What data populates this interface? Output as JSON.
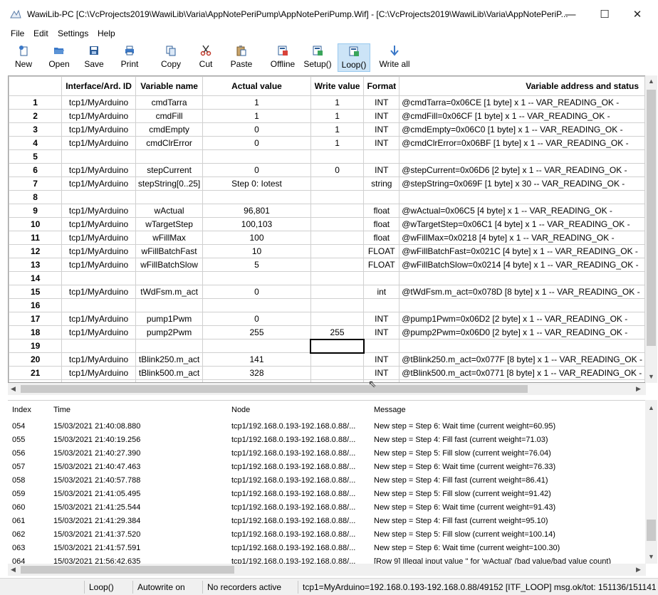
{
  "window": {
    "title": "WawiLib-PC [C:\\VcProjects2019\\WawiLib\\Varia\\AppNotePeriPump\\AppNotePeriPump.Wif] - [C:\\VcProjects2019\\WawiLib\\Varia\\AppNotePeriP...",
    "minimize": "—",
    "maximize": "☐",
    "close": "✕"
  },
  "menu": [
    "File",
    "Edit",
    "Settings",
    "Help"
  ],
  "toolbar": [
    {
      "label": "New",
      "icon": "new-icon"
    },
    {
      "label": "Open",
      "icon": "open-folder-icon"
    },
    {
      "label": "Save",
      "icon": "save-disk-icon"
    },
    {
      "label": "Print",
      "icon": "printer-icon"
    },
    {
      "label": "Copy",
      "icon": "copy-icon"
    },
    {
      "label": "Cut",
      "icon": "scissors-icon"
    },
    {
      "label": "Paste",
      "icon": "paste-icon"
    },
    {
      "label": "Offline",
      "icon": "offline-icon"
    },
    {
      "label": "Setup()",
      "icon": "setup-icon"
    },
    {
      "label": "Loop()",
      "icon": "loop-icon",
      "active": true
    },
    {
      "label": "Write all",
      "icon": "write-all-arrow-icon"
    }
  ],
  "grid": {
    "headers": [
      "Interface/Ard. ID",
      "Variable name",
      "Actual value",
      "Write value",
      "Format",
      "Variable address and status"
    ],
    "rows": [
      {
        "index": "1",
        "iface": "tcp1/MyArduino",
        "name": "cmdTarra",
        "actual": "1",
        "write": "1",
        "format": "INT",
        "status": "@cmdTarra=0x06CE [1 byte] x 1 -- VAR_READING_OK -"
      },
      {
        "index": "2",
        "iface": "tcp1/MyArduino",
        "name": "cmdFill",
        "actual": "1",
        "write": "1",
        "format": "INT",
        "status": "@cmdFill=0x06CF [1 byte] x 1 -- VAR_READING_OK -"
      },
      {
        "index": "3",
        "iface": "tcp1/MyArduino",
        "name": "cmdEmpty",
        "actual": "0",
        "write": "1",
        "format": "INT",
        "status": "@cmdEmpty=0x06C0 [1 byte] x 1 -- VAR_READING_OK -"
      },
      {
        "index": "4",
        "iface": "tcp1/MyArduino",
        "name": "cmdClrError",
        "actual": "0",
        "write": "1",
        "format": "INT",
        "status": "@cmdClrError=0x06BF [1 byte] x 1 -- VAR_READING_OK -"
      },
      {
        "index": "5",
        "iface": "",
        "name": "",
        "actual": "",
        "write": "",
        "format": "",
        "status": ""
      },
      {
        "index": "6",
        "iface": "tcp1/MyArduino",
        "name": "stepCurrent",
        "actual": "0",
        "write": "0",
        "format": "INT",
        "status": "@stepCurrent=0x06D6 [2 byte] x 1 -- VAR_READING_OK -"
      },
      {
        "index": "7",
        "iface": "tcp1/MyArduino",
        "name": "stepString[0..25]",
        "actual": "Step 0: Iotest",
        "write": "",
        "format": "string",
        "status": "@stepString=0x069F [1 byte] x 30 -- VAR_READING_OK -"
      },
      {
        "index": "8",
        "iface": "",
        "name": "",
        "actual": "",
        "write": "",
        "format": "",
        "status": ""
      },
      {
        "index": "9",
        "iface": "tcp1/MyArduino",
        "name": "wActual",
        "actual": "96,801",
        "write": "",
        "format": "float",
        "status": "@wActual=0x06C5 [4 byte] x 1 -- VAR_READING_OK -"
      },
      {
        "index": "10",
        "iface": "tcp1/MyArduino",
        "name": "wTargetStep",
        "actual": "100,103",
        "write": "",
        "format": "float",
        "status": "@wTargetStep=0x06C1 [4 byte] x 1 -- VAR_READING_OK -"
      },
      {
        "index": "11",
        "iface": "tcp1/MyArduino",
        "name": "wFillMax",
        "actual": "100",
        "write": "",
        "format": "float",
        "status": "@wFillMax=0x0218 [4 byte] x 1 -- VAR_READING_OK -"
      },
      {
        "index": "12",
        "iface": "tcp1/MyArduino",
        "name": "wFillBatchFast",
        "actual": "10",
        "write": "",
        "format": "FLOAT",
        "status": "@wFillBatchFast=0x021C [4 byte] x 1 -- VAR_READING_OK -"
      },
      {
        "index": "13",
        "iface": "tcp1/MyArduino",
        "name": "wFillBatchSlow",
        "actual": "5",
        "write": "",
        "format": "FLOAT",
        "status": "@wFillBatchSlow=0x0214 [4 byte] x 1 -- VAR_READING_OK -"
      },
      {
        "index": "14",
        "iface": "",
        "name": "",
        "actual": "",
        "write": "",
        "format": "",
        "status": ""
      },
      {
        "index": "15",
        "iface": "tcp1/MyArduino",
        "name": "tWdFsm.m_act",
        "actual": "0",
        "write": "",
        "format": "int",
        "status": "@tWdFsm.m_act=0x078D [8 byte] x 1 -- VAR_READING_OK -"
      },
      {
        "index": "16",
        "iface": "",
        "name": "",
        "actual": "",
        "write": "",
        "format": "",
        "status": ""
      },
      {
        "index": "17",
        "iface": "tcp1/MyArduino",
        "name": "pump1Pwm",
        "actual": "0",
        "write": "",
        "format": "INT",
        "status": "@pump1Pwm=0x06D2 [2 byte] x 1 -- VAR_READING_OK -"
      },
      {
        "index": "18",
        "iface": "tcp1/MyArduino",
        "name": "pump2Pwm",
        "actual": "255",
        "write": "255",
        "format": "INT",
        "status": "@pump2Pwm=0x06D0 [2 byte] x 1 -- VAR_READING_OK -"
      },
      {
        "index": "19",
        "iface": "",
        "name": "",
        "actual": "",
        "write": "",
        "format": "",
        "status": "",
        "selected": true
      },
      {
        "index": "20",
        "iface": "tcp1/MyArduino",
        "name": "tBlink250.m_act",
        "actual": "141",
        "write": "",
        "format": "INT",
        "status": "@tBlink250.m_act=0x077F [8 byte] x 1 -- VAR_READING_OK -"
      },
      {
        "index": "21",
        "iface": "tcp1/MyArduino",
        "name": "tBlink500.m_act",
        "actual": "328",
        "write": "",
        "format": "INT",
        "status": "@tBlink500.m_act=0x0771 [8 byte] x 1 -- VAR_READING_OK -"
      },
      {
        "index": "22",
        "iface": "",
        "name": "",
        "actual": "",
        "write": "",
        "format": "",
        "status": ""
      }
    ]
  },
  "log": {
    "headers": [
      "Index",
      "Time",
      "Node",
      "Message"
    ],
    "rows": [
      {
        "index": "054",
        "time": "15/03/2021 21:40:08.880",
        "node": "tcp1/192.168.0.193-192.168.0.88/...",
        "message": "New step = Step 6: Wait time (current weight=60.95)"
      },
      {
        "index": "055",
        "time": "15/03/2021 21:40:19.256",
        "node": "tcp1/192.168.0.193-192.168.0.88/...",
        "message": "New step = Step 4: Fill fast (current weight=71.03)"
      },
      {
        "index": "056",
        "time": "15/03/2021 21:40:27.390",
        "node": "tcp1/192.168.0.193-192.168.0.88/...",
        "message": "New step = Step 5: Fill slow (current weight=76.04)"
      },
      {
        "index": "057",
        "time": "15/03/2021 21:40:47.463",
        "node": "tcp1/192.168.0.193-192.168.0.88/...",
        "message": "New step = Step 6: Wait time (current weight=76.33)"
      },
      {
        "index": "058",
        "time": "15/03/2021 21:40:57.788",
        "node": "tcp1/192.168.0.193-192.168.0.88/...",
        "message": "New step = Step 4: Fill fast (current weight=86.41)"
      },
      {
        "index": "059",
        "time": "15/03/2021 21:41:05.495",
        "node": "tcp1/192.168.0.193-192.168.0.88/...",
        "message": "New step = Step 5: Fill slow (current weight=91.42)"
      },
      {
        "index": "060",
        "time": "15/03/2021 21:41:25.544",
        "node": "tcp1/192.168.0.193-192.168.0.88/...",
        "message": "New step = Step 6: Wait time (current weight=91.43)"
      },
      {
        "index": "061",
        "time": "15/03/2021 21:41:29.384",
        "node": "tcp1/192.168.0.193-192.168.0.88/...",
        "message": "New step = Step 4: Fill fast (current weight=95.10)"
      },
      {
        "index": "062",
        "time": "15/03/2021 21:41:37.520",
        "node": "tcp1/192.168.0.193-192.168.0.88/...",
        "message": "New step = Step 5: Fill slow (current weight=100.14)"
      },
      {
        "index": "063",
        "time": "15/03/2021 21:41:57.591",
        "node": "tcp1/192.168.0.193-192.168.0.88/...",
        "message": "New step = Step 6: Wait time (current weight=100.30)"
      },
      {
        "index": "064",
        "time": "15/03/2021 21:56:42.635",
        "node": "tcp1/192.168.0.193-192.168.0.88/...",
        "message": "[Row 9] Illegal input value '' for 'wActual' (bad value/bad value count)"
      }
    ]
  },
  "status": {
    "mode": "Loop()",
    "autowrite": "Autowrite on",
    "recorders": "No recorders active",
    "connection": "tcp1=MyArduino=192.168.0.193-192.168.0.88/49152 [ITF_LOOP] msg.ok/tot: 151136/151141"
  }
}
